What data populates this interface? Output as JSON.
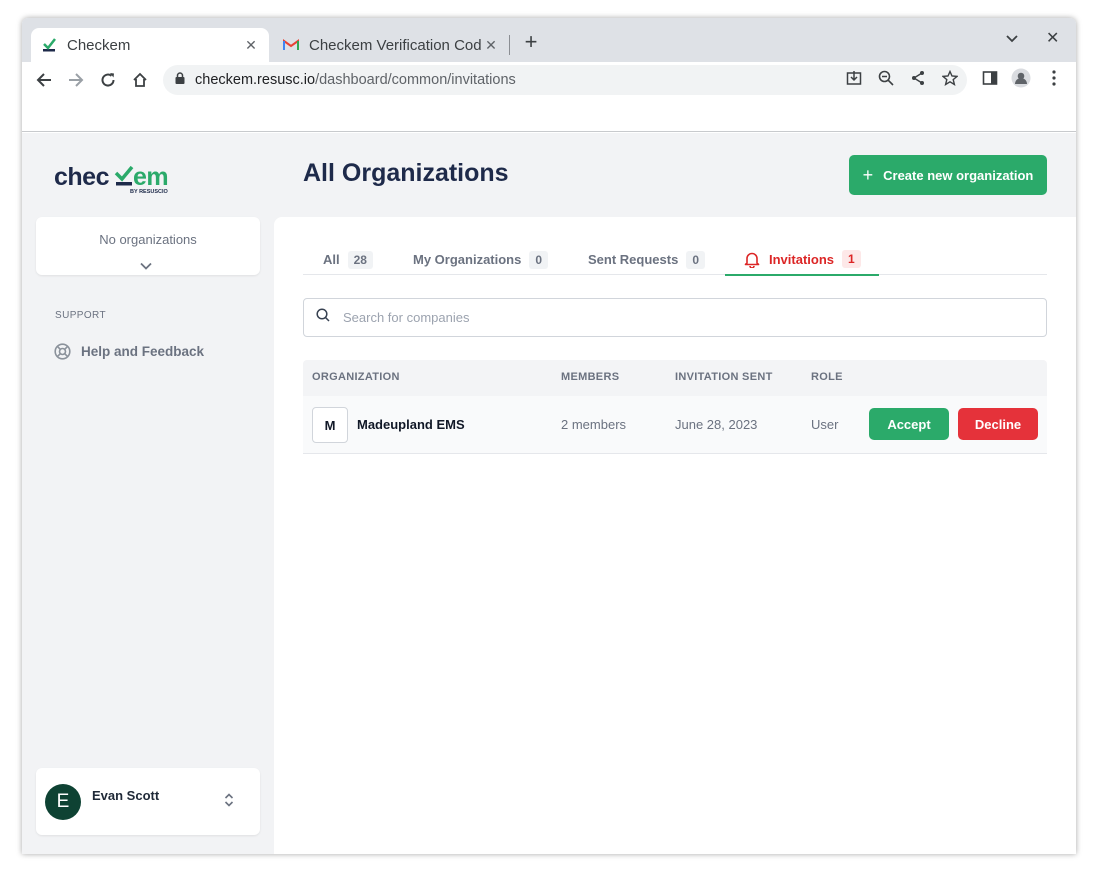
{
  "browser": {
    "tabs": [
      {
        "title": "Checkem",
        "active": true
      },
      {
        "title": "Checkem Verification Cod",
        "active": false
      }
    ],
    "url_host": "checkem.resusc.io",
    "url_path": "/dashboard/common/invitations"
  },
  "sidebar": {
    "logo_text": "checkem",
    "logo_sub": "BY RESUSCIO",
    "org_selector": "No organizations",
    "support_label": "SUPPORT",
    "help_label": "Help and Feedback",
    "user": {
      "initial": "E",
      "name": "Evan Scott"
    }
  },
  "header": {
    "title": "All Organizations",
    "create_button": "Create new organization"
  },
  "filter_tabs": [
    {
      "label": "All",
      "count": "28"
    },
    {
      "label": "My Organizations",
      "count": "0"
    },
    {
      "label": "Sent Requests",
      "count": "0"
    },
    {
      "label": "Invitations",
      "count": "1",
      "active": true
    }
  ],
  "search": {
    "placeholder": "Search for companies"
  },
  "table": {
    "columns": [
      "ORGANIZATION",
      "MEMBERS",
      "INVITATION SENT",
      "ROLE"
    ],
    "rows": [
      {
        "initial": "M",
        "name": "Madeupland EMS",
        "members": "2 members",
        "sent": "June 28, 2023",
        "role": "User",
        "accept": "Accept",
        "decline": "Decline"
      }
    ]
  },
  "colors": {
    "accent_green": "#2baa6a",
    "danger_red": "#e5323a",
    "title_navy": "#1e2a4a"
  }
}
